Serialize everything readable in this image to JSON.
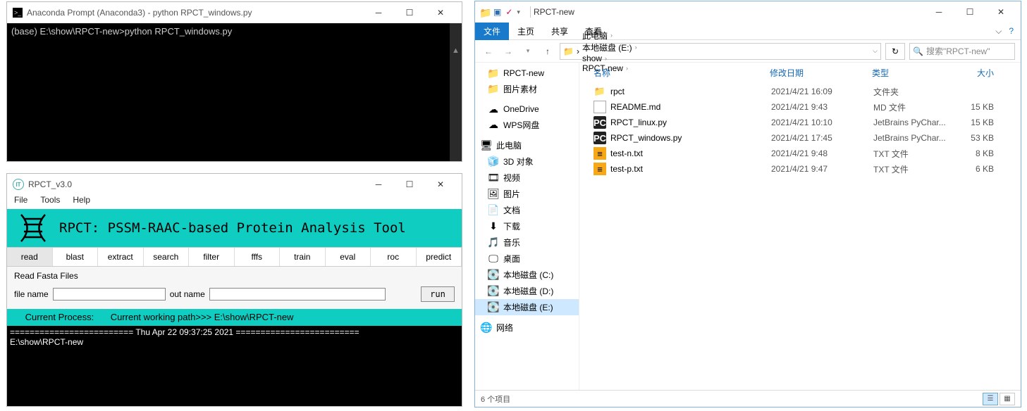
{
  "cmd": {
    "title": "Anaconda Prompt (Anaconda3) - python   RPCT_windows.py",
    "line": "(base) E:\\show\\RPCT-new>python RPCT_windows.py"
  },
  "rpct": {
    "title": "RPCT_v3.0",
    "menu": {
      "file": "File",
      "tools": "Tools",
      "help": "Help"
    },
    "banner": "RPCT: PSSM-RAAC-based Protein Analysis Tool",
    "tabs": [
      "read",
      "blast",
      "extract",
      "search",
      "filter",
      "fffs",
      "train",
      "eval",
      "roc",
      "predict"
    ],
    "active_tab": 0,
    "form": {
      "group": "Read Fasta Files",
      "file_name_label": "file name",
      "file_name_value": "",
      "out_name_label": "out name",
      "out_name_value": "",
      "run": "run"
    },
    "process": {
      "label": "Current Process:",
      "text": "Current working path>>> E:\\show\\RPCT-new"
    },
    "console_sep": "========================= Thu Apr 22 09:37:25 2021 =========================",
    "console_line": "E:\\show\\RPCT-new"
  },
  "explorer": {
    "title": "RPCT-new",
    "ribbon": {
      "file": "文件",
      "home": "主页",
      "share": "共享",
      "view": "查看"
    },
    "breadcrumbs": [
      "此电脑",
      "本地磁盘 (E:)",
      "show",
      "RPCT-new"
    ],
    "search_placeholder": "搜索\"RPCT-new\"",
    "columns": {
      "name": "名称",
      "date": "修改日期",
      "type": "类型",
      "size": "大小"
    },
    "nav": {
      "quick": [
        {
          "label": "RPCT-new",
          "icon": "folder"
        },
        {
          "label": "图片素材",
          "icon": "folder"
        }
      ],
      "cloud": [
        {
          "label": "OneDrive",
          "icon": "onedrive"
        },
        {
          "label": "WPS网盘",
          "icon": "wps"
        }
      ],
      "thispc_label": "此电脑",
      "thispc": [
        {
          "label": "3D 对象",
          "icon": "3d"
        },
        {
          "label": "视频",
          "icon": "video"
        },
        {
          "label": "图片",
          "icon": "image"
        },
        {
          "label": "文档",
          "icon": "doc"
        },
        {
          "label": "下载",
          "icon": "download"
        },
        {
          "label": "音乐",
          "icon": "music"
        },
        {
          "label": "桌面",
          "icon": "desktop"
        },
        {
          "label": "本地磁盘 (C:)",
          "icon": "disk"
        },
        {
          "label": "本地磁盘 (D:)",
          "icon": "disk"
        },
        {
          "label": "本地磁盘 (E:)",
          "icon": "disk",
          "selected": true
        }
      ],
      "network": "网络"
    },
    "files": [
      {
        "name": "rpct",
        "date": "2021/4/21 16:09",
        "type": "文件夹",
        "size": "",
        "icon": "folder"
      },
      {
        "name": "README.md",
        "date": "2021/4/21 9:43",
        "type": "MD 文件",
        "size": "15 KB",
        "icon": "md"
      },
      {
        "name": "RPCT_linux.py",
        "date": "2021/4/21 10:10",
        "type": "JetBrains PyChar...",
        "size": "15 KB",
        "icon": "pc"
      },
      {
        "name": "RPCT_windows.py",
        "date": "2021/4/21 17:45",
        "type": "JetBrains PyChar...",
        "size": "53 KB",
        "icon": "pc"
      },
      {
        "name": "test-n.txt",
        "date": "2021/4/21 9:48",
        "type": "TXT 文件",
        "size": "8 KB",
        "icon": "txt"
      },
      {
        "name": "test-p.txt",
        "date": "2021/4/21 9:47",
        "type": "TXT 文件",
        "size": "6 KB",
        "icon": "txt"
      }
    ],
    "status": "6 个项目"
  }
}
